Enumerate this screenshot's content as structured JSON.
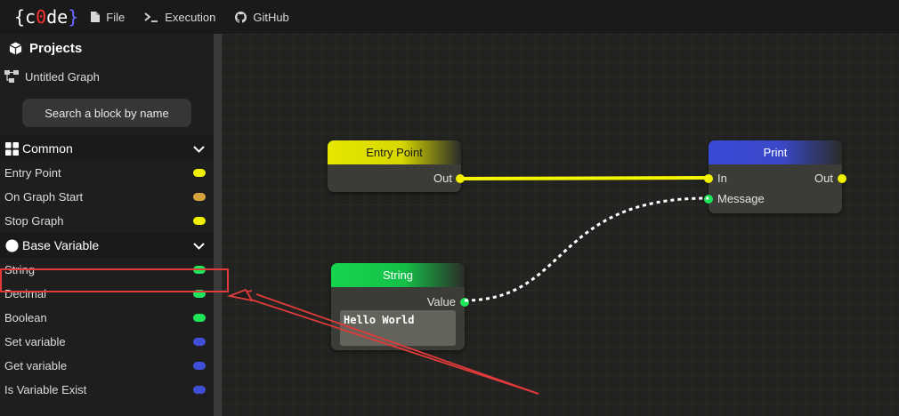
{
  "topbar": {
    "logo": {
      "brace_left": "{",
      "c": "c",
      "zero": "0",
      "de": "de",
      "brace_right": "}"
    },
    "menu": [
      {
        "label": "File",
        "icon": "file-icon"
      },
      {
        "label": "Execution",
        "icon": "terminal-icon"
      },
      {
        "label": "GitHub",
        "icon": "github-icon"
      }
    ]
  },
  "sidebar": {
    "projects_title": "Projects",
    "project_items": [
      {
        "label": "Untitled Graph",
        "icon": "graph-icon"
      }
    ],
    "search_label": "Search a block by name",
    "sections": [
      {
        "title": "Common",
        "icon": "grid-icon",
        "items": [
          {
            "label": "Entry Point",
            "color": "#f0f000"
          },
          {
            "label": "On Graph Start",
            "color": "#d4a43a"
          },
          {
            "label": "Stop Graph",
            "color": "#f0f000"
          }
        ]
      },
      {
        "title": "Base Variable",
        "icon": "circle-icon",
        "items": [
          {
            "label": "String",
            "color": "#1ee65a"
          },
          {
            "label": "Decimal",
            "color": "#1ee65a"
          },
          {
            "label": "Boolean",
            "color": "#1ee65a"
          },
          {
            "label": "Set variable",
            "color": "#3e4ed6"
          },
          {
            "label": "Get variable",
            "color": "#3e4ed6"
          },
          {
            "label": "Is Variable Exist",
            "color": "#3e4ed6"
          }
        ]
      }
    ]
  },
  "nodes": {
    "entry_point": {
      "title": "Entry Point",
      "out_label": "Out",
      "header_color": "#e6e600"
    },
    "print": {
      "title": "Print",
      "in_label": "In",
      "out_label": "Out",
      "message_label": "Message",
      "header_color": "#3a4ad8"
    },
    "string": {
      "title": "String",
      "value_label": "Value",
      "value": "Hello World",
      "header_color": "#16d44e"
    }
  },
  "colors": {
    "exec_wire": "#f5f500",
    "data_wire": "#ffffff",
    "annotation": "#e03a3a",
    "pin_yellow": "#f0f000",
    "pin_green": "#1ee65a"
  }
}
